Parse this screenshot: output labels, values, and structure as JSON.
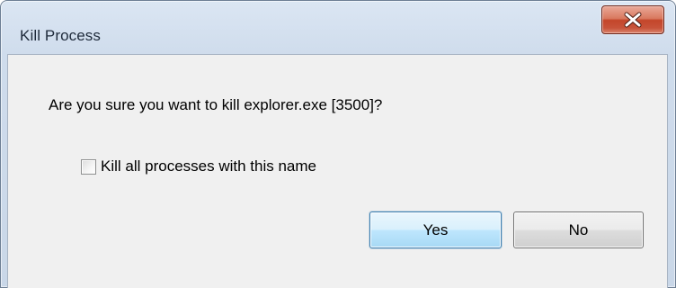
{
  "dialog": {
    "title": "Kill Process",
    "close_icon": "close-icon",
    "message": "Are you sure you want to kill explorer.exe [3500]?",
    "checkbox": {
      "label": "Kill all processes with this name",
      "checked": false
    },
    "buttons": {
      "yes_label": "Yes",
      "no_label": "No",
      "default": "Yes"
    }
  },
  "colors": {
    "close_button": "#c8533a",
    "default_button_border": "#3c7fb1",
    "client_background": "#f0f0f0"
  }
}
